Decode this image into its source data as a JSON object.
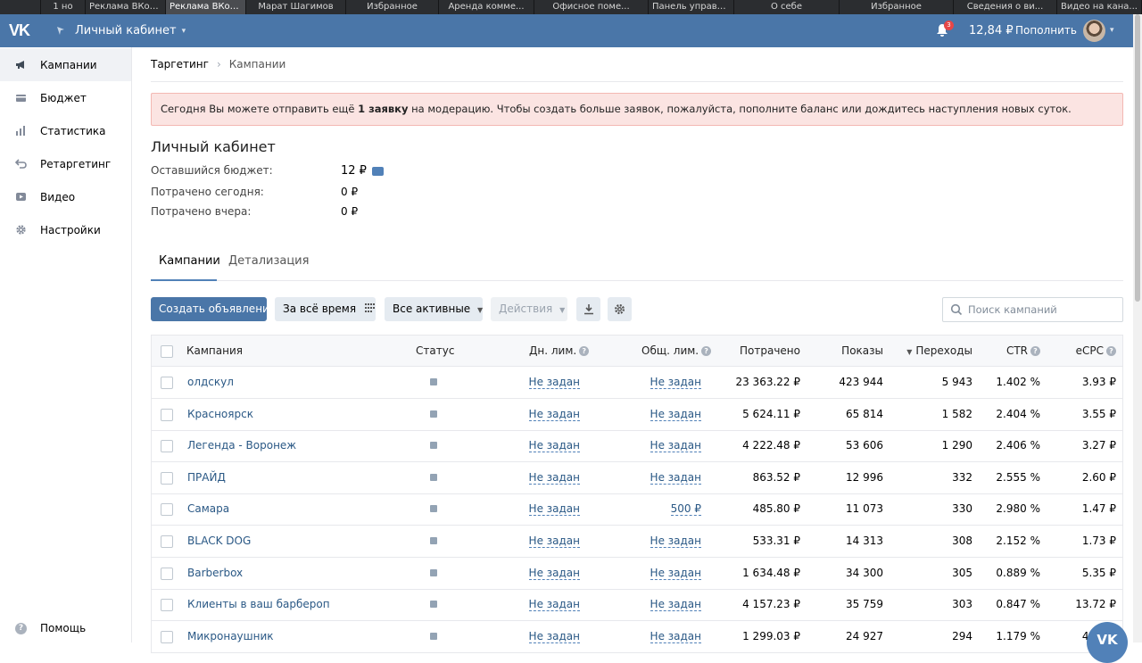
{
  "browser_tabs": [
    "1 но",
    "Реклама ВКон...",
    "Реклама ВКон...",
    "Марат Шагимов",
    "Избранное",
    "Аренда комме...",
    "Офисное поме...",
    "Панель управл...",
    "О себе",
    "Избранное",
    "Сведения о ви...",
    "Видео на кана..."
  ],
  "header": {
    "cabinet": "Личный кабинет",
    "notifications_count": "3",
    "balance": "12,84 ₽",
    "topup": "Пополнить"
  },
  "sidebar": {
    "items": [
      {
        "label": "Кампании",
        "icon": "megaphone-icon"
      },
      {
        "label": "Бюджет",
        "icon": "wallet-icon"
      },
      {
        "label": "Статистика",
        "icon": "stats-icon"
      },
      {
        "label": "Ретаргетинг",
        "icon": "retarget-icon"
      },
      {
        "label": "Видео",
        "icon": "video-icon"
      },
      {
        "label": "Настройки",
        "icon": "gear-icon"
      }
    ],
    "help": "Помощь"
  },
  "breadcrumb": {
    "parent": "Таргетинг",
    "sep": "›",
    "current": "Кампании"
  },
  "alert": {
    "pre": "Сегодня Вы можете отправить ещё ",
    "bold": "1 заявку",
    "post": " на модерацию. Чтобы создать больше заявок, пожалуйста, пополните баланс или дождитесь наступления новых суток."
  },
  "cabinet": {
    "title": "Личный кабинет",
    "stats": [
      {
        "label": "Оставшийся бюджет:",
        "value": "12 ₽"
      },
      {
        "label": "Потрачено сегодня:",
        "value": "0 ₽"
      },
      {
        "label": "Потрачено вчера:",
        "value": "0 ₽"
      }
    ]
  },
  "tabs": [
    "Кампании",
    "Детализация"
  ],
  "toolbar": {
    "create": "Создать объявление",
    "period": "За всё время",
    "filter": "Все активные",
    "actions": "Действия",
    "search_placeholder": "Поиск кампаний"
  },
  "table": {
    "headers": {
      "campaign": "Кампания",
      "status": "Статус",
      "day_limit": "Дн. лим.",
      "total_limit": "Общ. лим.",
      "spent": "Потрачено",
      "impressions": "Показы",
      "clicks": "Переходы",
      "ctr": "CTR",
      "ecpc": "eCPC"
    },
    "rows": [
      {
        "name": "олдскул",
        "day": "Не задан",
        "total": "Не задан",
        "spent": "23 363.22 ₽",
        "impressions": "423 944",
        "clicks": "5 943",
        "ctr": "1.402 %",
        "ecpc": "3.93 ₽"
      },
      {
        "name": "Красноярск",
        "day": "Не задан",
        "total": "Не задан",
        "spent": "5 624.11 ₽",
        "impressions": "65 814",
        "clicks": "1 582",
        "ctr": "2.404 %",
        "ecpc": "3.55 ₽"
      },
      {
        "name": "Легенда - Воронеж",
        "day": "Не задан",
        "total": "Не задан",
        "spent": "4 222.48 ₽",
        "impressions": "53 606",
        "clicks": "1 290",
        "ctr": "2.406 %",
        "ecpc": "3.27 ₽"
      },
      {
        "name": "ПРАЙД",
        "day": "Не задан",
        "total": "Не задан",
        "spent": "863.52 ₽",
        "impressions": "12 996",
        "clicks": "332",
        "ctr": "2.555 %",
        "ecpc": "2.60 ₽"
      },
      {
        "name": "Самара",
        "day": "Не задан",
        "total": "500 ₽",
        "spent": "485.80 ₽",
        "impressions": "11 073",
        "clicks": "330",
        "ctr": "2.980 %",
        "ecpc": "1.47 ₽"
      },
      {
        "name": "BLACK DOG",
        "day": "Не задан",
        "total": "Не задан",
        "spent": "533.31 ₽",
        "impressions": "14 313",
        "clicks": "308",
        "ctr": "2.152 %",
        "ecpc": "1.73 ₽"
      },
      {
        "name": "Barberbox",
        "day": "Не задан",
        "total": "Не задан",
        "spent": "1 634.48 ₽",
        "impressions": "34 300",
        "clicks": "305",
        "ctr": "0.889 %",
        "ecpc": "5.35 ₽"
      },
      {
        "name": "Клиенты в ваш барбероп",
        "day": "Не задан",
        "total": "Не задан",
        "spent": "4 157.23 ₽",
        "impressions": "35 759",
        "clicks": "303",
        "ctr": "0.847 %",
        "ecpc": "13.72 ₽"
      },
      {
        "name": "Микронаушник",
        "day": "Не задан",
        "total": "Не задан",
        "spent": "1 299.03 ₽",
        "impressions": "24 927",
        "clicks": "294",
        "ctr": "1.179 %",
        "ecpc": "4.42 ₽"
      }
    ]
  },
  "colors": {
    "header": "#4a76a8",
    "link": "#2a5885",
    "alert_bg": "#fbe4e2"
  }
}
